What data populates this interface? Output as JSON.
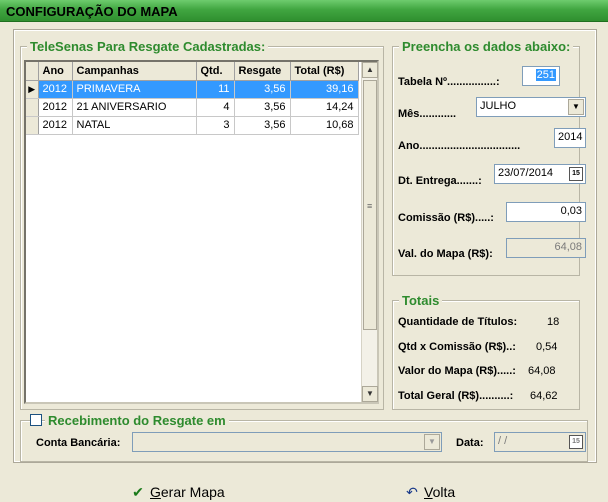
{
  "window": {
    "title": "CONFIGURAÇÃO DO MAPA"
  },
  "grid_group": {
    "title": "TeleSenas Para Resgate Cadastradas:",
    "columns": [
      "Ano",
      "Campanhas",
      "Qtd.",
      "Resgate",
      "Total (R$)"
    ],
    "rows": [
      {
        "ano": "2012",
        "campanha": "PRIMAVERA",
        "qtd": "11",
        "resgate": "3,56",
        "total": "39,16"
      },
      {
        "ano": "2012",
        "campanha": "21 ANIVERSARIO",
        "qtd": "4",
        "resgate": "3,56",
        "total": "14,24"
      },
      {
        "ano": "2012",
        "campanha": "NATAL",
        "qtd": "3",
        "resgate": "3,56",
        "total": "10,68"
      }
    ]
  },
  "form": {
    "title": "Preencha os dados abaixo:",
    "tabela_label": "Tabela Nº................:",
    "tabela_value": "251",
    "mes_label": "Mês............",
    "mes_value": "JULHO",
    "ano_label": "Ano.................................",
    "ano_value": "2014",
    "dt_label": "Dt. Entrega.......:",
    "dt_value": "23/07/2014",
    "comissao_label": "Comissão (R$).....:",
    "comissao_value": "0,03",
    "valmapa_label": "Val. do Mapa (R$):",
    "valmapa_value": "64,08",
    "cal_icon_text": "15"
  },
  "totais": {
    "title": "Totais",
    "qtd_titulos_label": "Quantidade de Títulos:",
    "qtd_titulos_value": "18",
    "qtd_comissao_label": "Qtd x Comissão (R$)..:",
    "qtd_comissao_value": "0,54",
    "valor_mapa_label": "Valor do Mapa (R$).....:",
    "valor_mapa_value": "64,08",
    "total_geral_label": "Total Geral (R$)..........:",
    "total_geral_value": "64,62"
  },
  "recebimento": {
    "title": "Recebimento do Resgate em",
    "conta_label": "Conta Bancária:",
    "conta_value": "",
    "data_label": "Data:",
    "data_value": "/  /"
  },
  "footer": {
    "gerar_label": "erar Mapa",
    "gerar_mnemonic": "G",
    "voltar_label": "olta",
    "voltar_mnemonic": "V"
  }
}
